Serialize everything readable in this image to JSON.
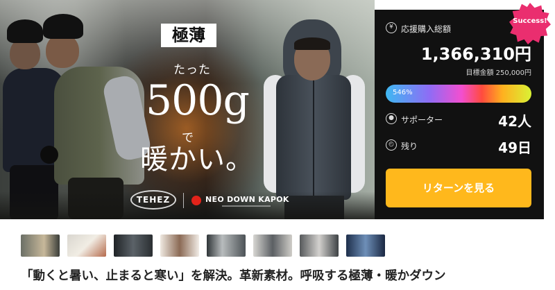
{
  "hero": {
    "badge": "極薄",
    "line1": "たった",
    "weight": "500g",
    "line2": "で",
    "line3": "暖かい。",
    "brand_left": "TEHEZ",
    "brand_right": "NEO DOWN KAPOK"
  },
  "panel": {
    "success_badge": "Success!",
    "raised_label": "応援購入総額",
    "raised_amount": "1,366,310円",
    "target": "目標金額 250,000円",
    "progress_text": "546%",
    "progress_value": 5.46,
    "supporters_label": "サポーター",
    "supporters_value": "42人",
    "remaining_label": "残り",
    "remaining_value": "49日",
    "return_button": "リターンを見る",
    "icons": [
      "yen-icon",
      "person-icon",
      "clock-icon"
    ]
  },
  "thumbnails": [
    "thumb-1",
    "thumb-2",
    "thumb-3",
    "thumb-4",
    "thumb-5",
    "thumb-6",
    "thumb-7",
    "thumb-8"
  ],
  "title": "「動くと暑い、止まると寒い」を解決。革新素材。呼吸する極薄・暖かダウン",
  "colors": {
    "panel_bg": "#111111",
    "button": "#ffb81c",
    "success": "#ea2e6f"
  }
}
